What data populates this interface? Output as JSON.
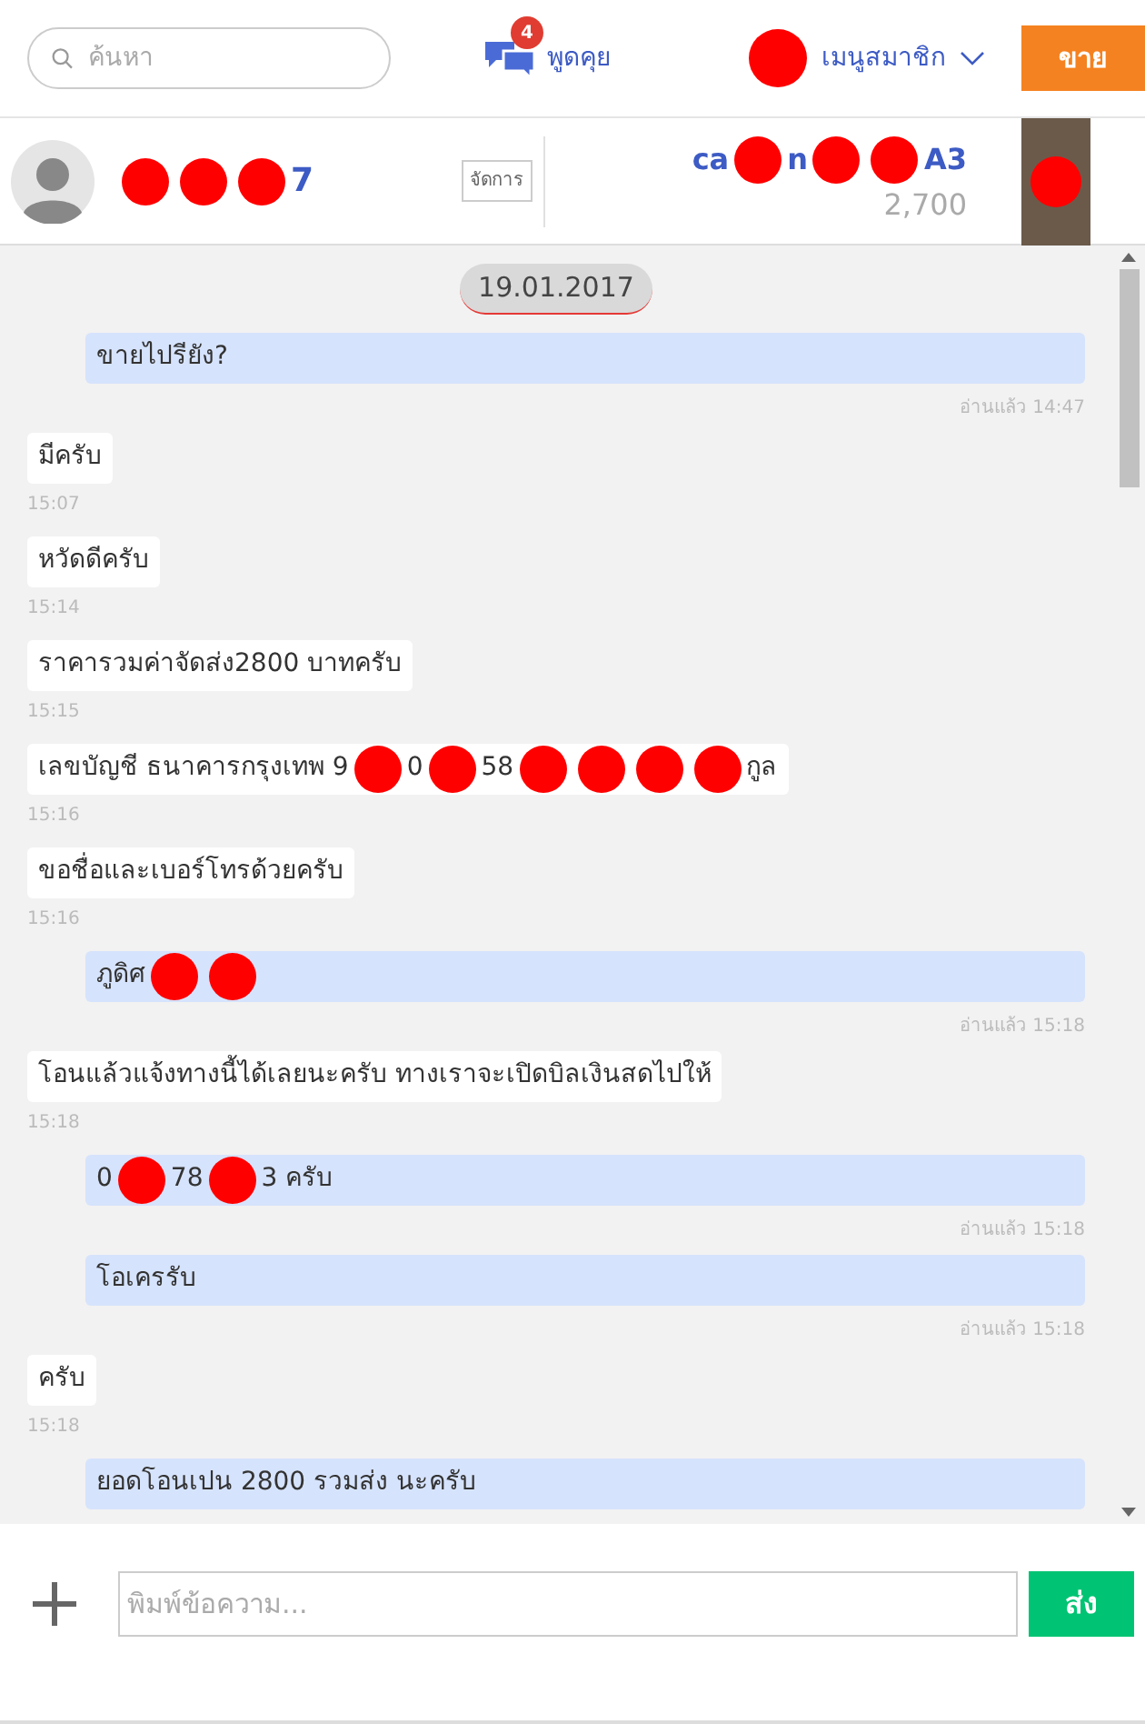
{
  "header": {
    "search": {
      "placeholder": "ค้นหา"
    },
    "chat_link": {
      "label": "พูดคุย",
      "badge": "4"
    },
    "member_menu": {
      "label": "เมนูสมาชิก"
    },
    "sell_button": "ขาย"
  },
  "conversation": {
    "user_segments": [
      {
        "kind": "redaction"
      },
      {
        "kind": "redaction"
      },
      {
        "kind": "redaction"
      },
      {
        "kind": "text",
        "text": "7"
      }
    ],
    "manage_button": "จัดการ",
    "product_segments": [
      {
        "kind": "text",
        "text": "ca"
      },
      {
        "kind": "redaction"
      },
      {
        "kind": "text",
        "text": "n"
      },
      {
        "kind": "redaction"
      },
      {
        "kind": "redaction"
      },
      {
        "kind": "text",
        "text": "A3"
      }
    ],
    "price": "2,700"
  },
  "date": "19.01.2017",
  "messages": [
    {
      "kind": "outgoing",
      "segments": [
        {
          "kind": "text",
          "text": "ขายไปรียัง?"
        }
      ],
      "time": "อ่านแล้ว 14:47"
    },
    {
      "kind": "incoming",
      "segments": [
        {
          "kind": "text",
          "text": "มีครับ"
        }
      ],
      "time": "15:07"
    },
    {
      "kind": "incoming",
      "segments": [
        {
          "kind": "text",
          "text": "หวัดดีครับ"
        }
      ],
      "time": "15:14"
    },
    {
      "kind": "incoming",
      "segments": [
        {
          "kind": "text",
          "text": "ราคารวมค่าจัดส่ง2800 บาทครับ"
        }
      ],
      "time": "15:15"
    },
    {
      "kind": "incoming",
      "segments": [
        {
          "kind": "text",
          "text": "เลขบัญชี ธนาคารกรุงเทพ 9"
        },
        {
          "kind": "redaction"
        },
        {
          "kind": "text",
          "text": "0"
        },
        {
          "kind": "redaction"
        },
        {
          "kind": "text",
          "text": "58"
        },
        {
          "kind": "redaction"
        },
        {
          "kind": "redaction"
        },
        {
          "kind": "redaction"
        },
        {
          "kind": "redaction"
        },
        {
          "kind": "text",
          "text": "กูล"
        }
      ],
      "time": "15:16"
    },
    {
      "kind": "incoming",
      "segments": [
        {
          "kind": "text",
          "text": "ขอชื่อและเบอร์โทรด้วยครับ"
        }
      ],
      "time": "15:16"
    },
    {
      "kind": "outgoing",
      "segments": [
        {
          "kind": "text",
          "text": "ภูดิศ"
        },
        {
          "kind": "redaction"
        },
        {
          "kind": "redaction"
        }
      ],
      "time": "อ่านแล้ว 15:18"
    },
    {
      "kind": "incoming",
      "segments": [
        {
          "kind": "text",
          "text": "โอนแล้วแจ้งทางนี้ได้เลยนะครับ ทางเราจะเปิดบิลเงินสดไปให้"
        }
      ],
      "time": "15:18"
    },
    {
      "kind": "outgoing",
      "segments": [
        {
          "kind": "text",
          "text": "0"
        },
        {
          "kind": "redaction"
        },
        {
          "kind": "text",
          "text": "78"
        },
        {
          "kind": "redaction"
        },
        {
          "kind": "text",
          "text": "3 ครับ"
        }
      ],
      "time": "อ่านแล้ว 15:18"
    },
    {
      "kind": "outgoing",
      "segments": [
        {
          "kind": "text",
          "text": "โอเครรับ"
        }
      ],
      "time": "อ่านแล้ว 15:18"
    },
    {
      "kind": "incoming",
      "segments": [
        {
          "kind": "text",
          "text": "ครับ"
        }
      ],
      "time": "15:18"
    },
    {
      "kind": "outgoing",
      "segments": [
        {
          "kind": "text",
          "text": "ยอดโอนเปน 2800 รวมส่ง นะครับ"
        }
      ]
    }
  ],
  "composer": {
    "placeholder": "พิมพ์ข้อความ...",
    "send_button": "ส่ง"
  }
}
